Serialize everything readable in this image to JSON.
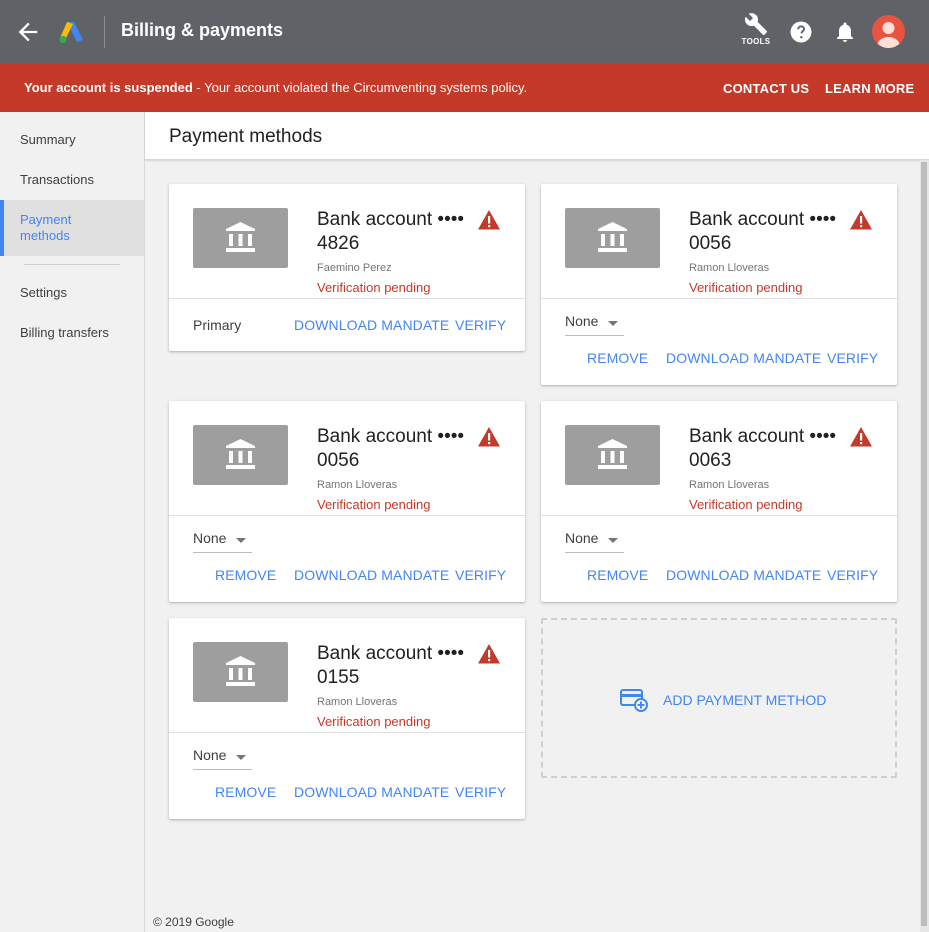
{
  "header": {
    "title": "Billing & payments",
    "tools_label": "TOOLS"
  },
  "banner": {
    "bold": "Your account is suspended",
    "message": " - Your account violated the Circumventing systems policy.",
    "contact": "CONTACT US",
    "learn": "LEARN MORE"
  },
  "sidebar": {
    "items": [
      {
        "label": "Summary"
      },
      {
        "label": "Transactions"
      },
      {
        "label": "Payment methods"
      },
      {
        "label": "Settings"
      },
      {
        "label": "Billing transfers"
      }
    ]
  },
  "page": {
    "title": "Payment methods"
  },
  "cards": [
    {
      "title": "Bank account •••• 4826",
      "owner": "Faemino Perez",
      "status": "Verification pending",
      "primary": "Primary",
      "download": "DOWNLOAD MANDATE",
      "verify": "VERIFY"
    },
    {
      "title": "Bank account •••• 0056",
      "owner": "Ramon Lloveras",
      "status": "Verification pending",
      "select": "None",
      "remove": "REMOVE",
      "download": "DOWNLOAD MANDATE",
      "verify": "VERIFY"
    },
    {
      "title": "Bank account •••• 0056",
      "owner": "Ramon Lloveras",
      "status": "Verification pending",
      "select": "None",
      "remove": "REMOVE",
      "download": "DOWNLOAD MANDATE",
      "verify": "VERIFY"
    },
    {
      "title": "Bank account •••• 0063",
      "owner": "Ramon Lloveras",
      "status": "Verification pending",
      "select": "None",
      "remove": "REMOVE",
      "download": "DOWNLOAD MANDATE",
      "verify": "VERIFY"
    },
    {
      "title": "Bank account •••• 0155",
      "owner": "Ramon Lloveras",
      "status": "Verification pending",
      "select": "None",
      "remove": "REMOVE",
      "download": "DOWNLOAD MANDATE",
      "verify": "VERIFY"
    }
  ],
  "add_payment": {
    "label": "ADD PAYMENT METHOD"
  },
  "footer": {
    "text": "© 2019 Google"
  },
  "colors": {
    "topbar": "#5f6368",
    "banner": "#c53929",
    "accent": "#4285f4",
    "warning": "#c53929",
    "avatar": "#e8543f"
  },
  "icons": [
    "back-arrow-icon",
    "google-ads-logo",
    "wrench-icon",
    "help-icon",
    "bell-icon",
    "account-avatar",
    "bank-icon",
    "warning-icon",
    "dropdown-caret-icon",
    "add-card-icon"
  ]
}
